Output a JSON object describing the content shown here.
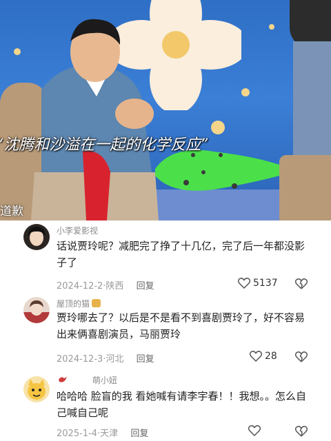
{
  "video": {
    "caption": "“沈腾和沙溢在一起的化学反应”",
    "corner_text": "道歉"
  },
  "comments": [
    {
      "user": "小李爱影视",
      "text": "话说贾玲呢？减肥完了挣了十几亿，完了后一年都没影子了",
      "date": "2024-12-2",
      "location": "陕西",
      "reply_label": "回复",
      "likes": "5137"
    },
    {
      "user": "屋顶的猫",
      "text": "贾玲哪去了？以后是不是看不到喜剧贾玲了，好不容易出来俩喜剧演员，马丽贾玲",
      "date": "2024-12-3",
      "location": "河北",
      "reply_label": "回复",
      "likes": "28"
    },
    {
      "user": "萌小妞",
      "text": "哈哈哈 脸盲的我 看她喊有请李宇春！！我想。。怎么自己喊自己呢",
      "date": "2025-1-4",
      "location": "天津",
      "reply_label": "回复",
      "likes": ""
    }
  ],
  "icons": [
    "heart-icon",
    "broken-heart-icon",
    "cat-badge-icon",
    "bird-badge-icon"
  ]
}
